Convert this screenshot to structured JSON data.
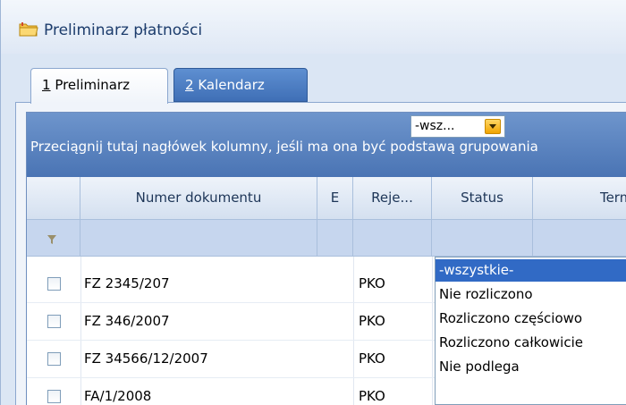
{
  "window": {
    "title": "Preliminarz płatności",
    "icon": "folder-icon"
  },
  "tabs": [
    {
      "number": "1",
      "label": " Preliminarz",
      "active": true
    },
    {
      "number": "2",
      "label": " Kalendarz",
      "active": false
    }
  ],
  "grid": {
    "group_hint": "Przeciągnij tutaj nagłówek kolumny, jeśli ma ona być podstawą grupowania",
    "columns": {
      "numer": "Numer dokumentu",
      "e": "E",
      "rejestr": "Reje...",
      "status": "Status",
      "termin": "Termin"
    },
    "filter": {
      "status_value": "-wsz...",
      "icon": "funnel-icon"
    },
    "rows": [
      {
        "numer": "FZ 2345/207",
        "rejestr": "PKO"
      },
      {
        "numer": "FZ 346/2007",
        "rejestr": "PKO"
      },
      {
        "numer": "FZ 34566/12/2007",
        "rejestr": "PKO"
      },
      {
        "numer": "FA/1/2008",
        "rejestr": "PKO"
      }
    ]
  },
  "status_dropdown": {
    "options": [
      "-wszystkie-",
      "Nie rozliczono",
      "Rozliczono częściowo",
      "Rozliczono całkowicie",
      "Nie podlega"
    ],
    "selected_index": 0
  },
  "colors": {
    "accent": "#316ac5",
    "tab_inactive": "#4a7bc0",
    "combo_button": "#f5b400"
  }
}
